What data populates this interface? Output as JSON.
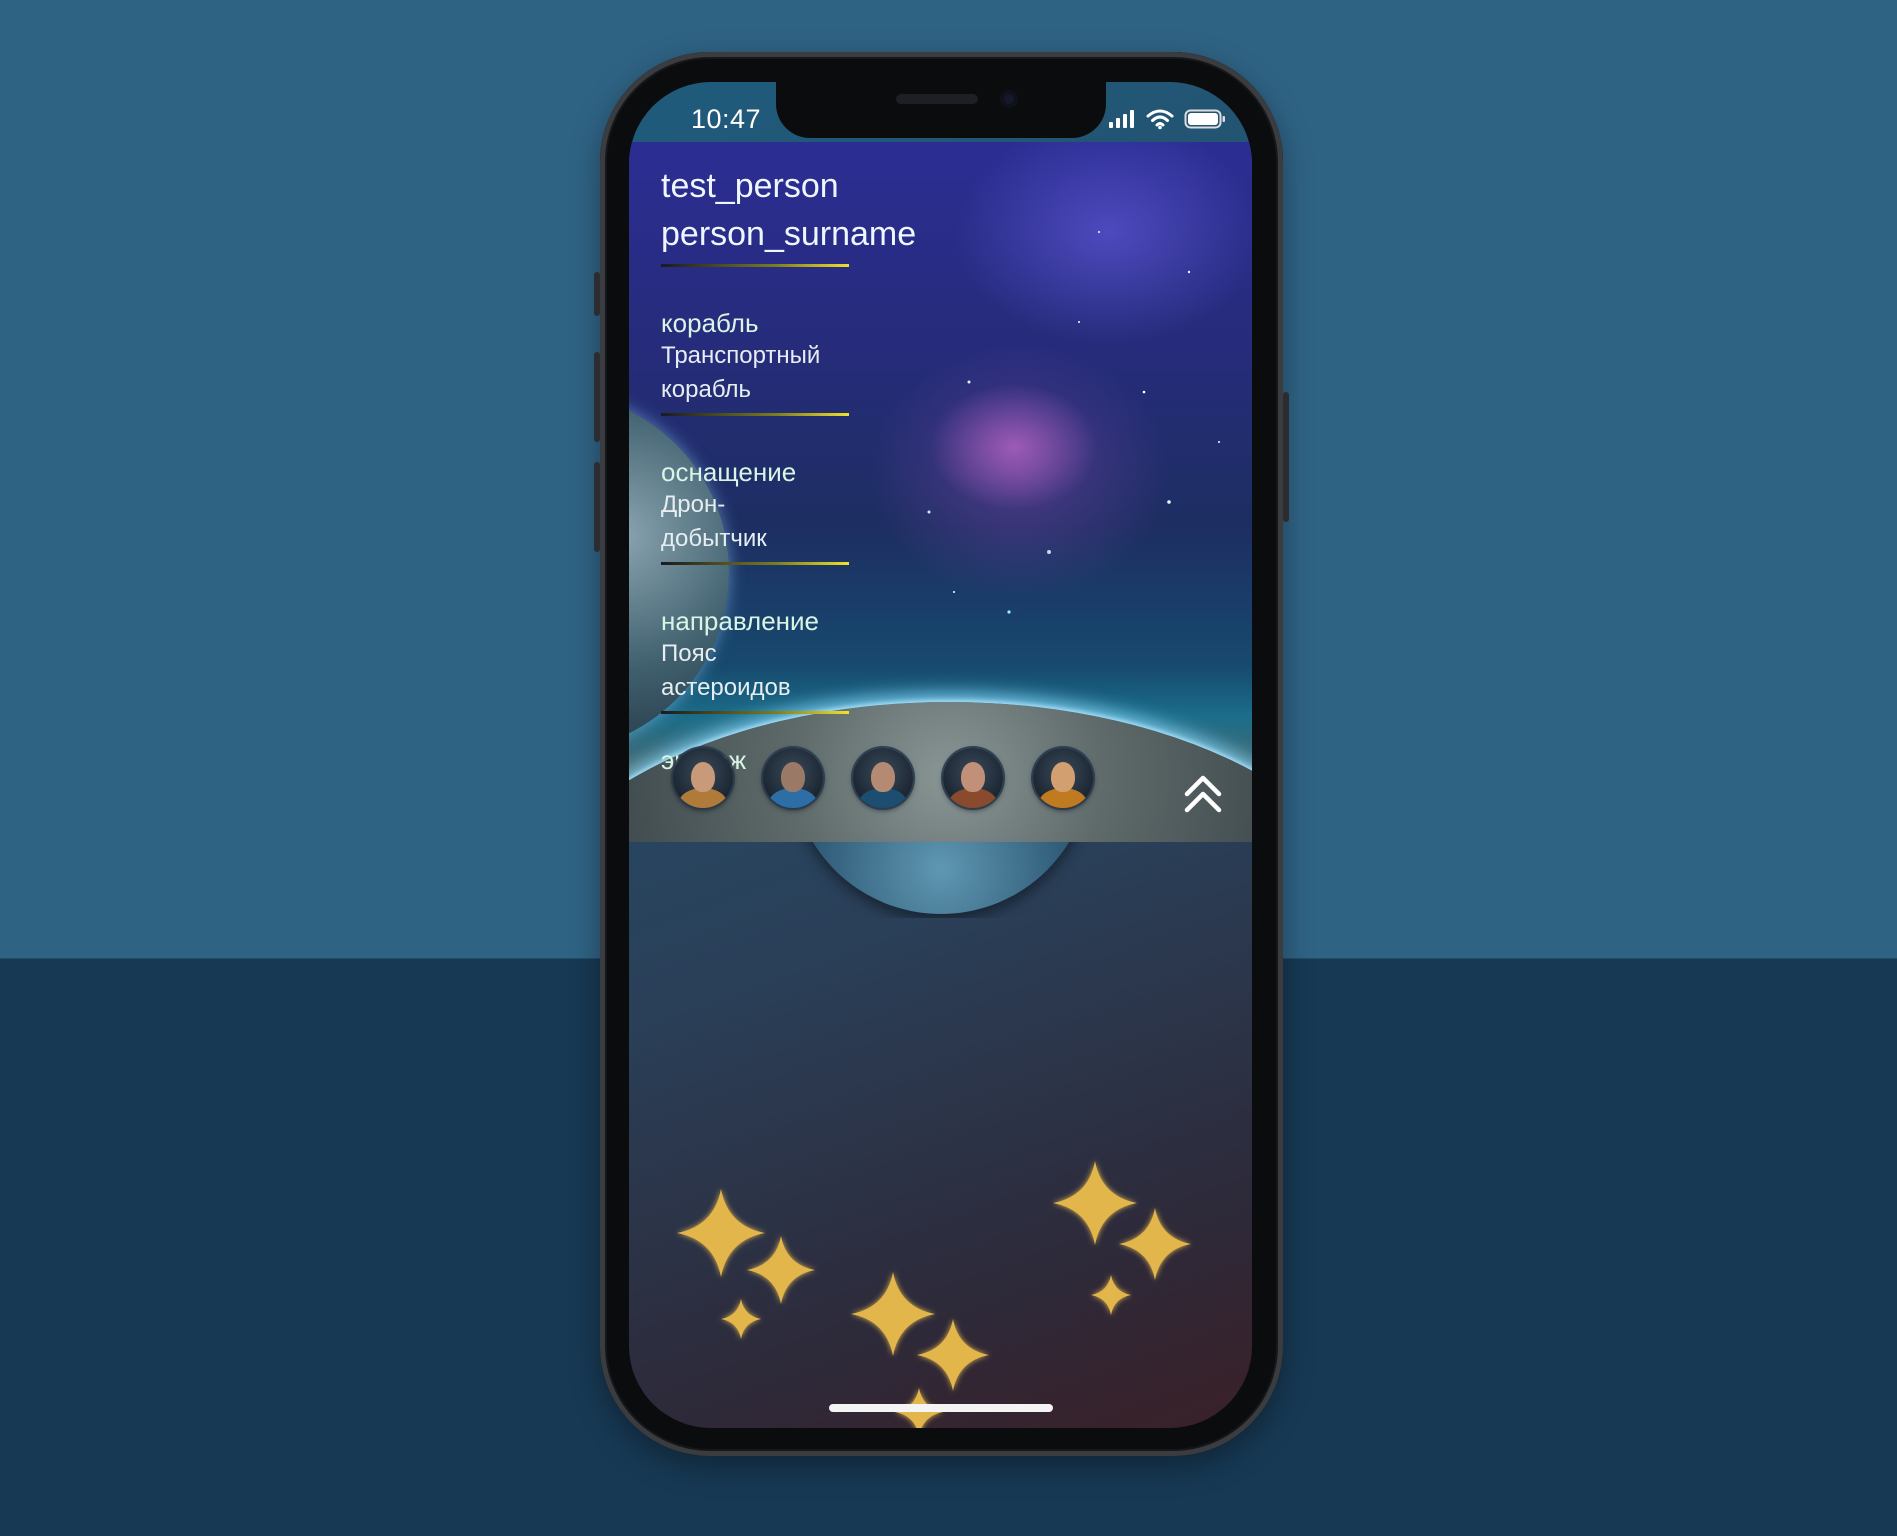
{
  "status_bar": {
    "time": "10:47"
  },
  "profile": {
    "first_name": "test_person",
    "last_name": "person_surname"
  },
  "fields": [
    {
      "label": "корабль",
      "value_line1": "Транспортный",
      "value_line2": "корабль"
    },
    {
      "label": "оснащение",
      "value_line1": "Дрон-",
      "value_line2": "добытчик"
    },
    {
      "label": "направление",
      "value_line1": "Пояс",
      "value_line2": "астероидов"
    }
  ],
  "crew": {
    "label": "экипаж",
    "members": [
      {
        "id": "crew-member-1",
        "face": "#c99a7a",
        "suit": "#b07a3a"
      },
      {
        "id": "crew-member-2",
        "face": "#9a7a66",
        "suit": "#2d6ea6"
      },
      {
        "id": "crew-member-3",
        "face": "#b48a72",
        "suit": "#1e4d72"
      },
      {
        "id": "crew-member-4",
        "face": "#c09078",
        "suit": "#8a4a2e"
      },
      {
        "id": "crew-member-5",
        "face": "#d2a070",
        "suit": "#c07a20"
      }
    ]
  },
  "icons": {
    "collapse": "double-chevron-up-icon",
    "signal": "cellular-signal-icon",
    "wifi": "wifi-icon",
    "battery": "battery-icon",
    "decoration": "sparkle-icon"
  },
  "colors": {
    "background_top": "#2f6384",
    "background_bottom": "#173954",
    "separator_accent": "#f0e12a",
    "sparkle": "#e2b64c"
  }
}
